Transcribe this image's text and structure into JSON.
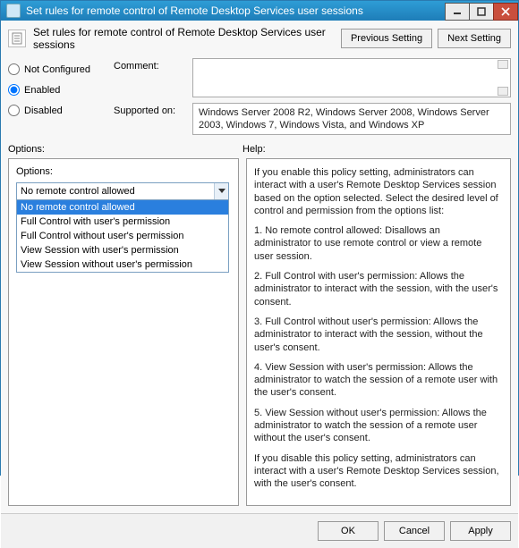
{
  "window": {
    "title": "Set rules for remote control of Remote Desktop Services user sessions"
  },
  "header": {
    "caption": "Set rules for remote control of Remote Desktop Services user sessions",
    "prev": "Previous Setting",
    "next": "Next Setting"
  },
  "state": {
    "not_configured": "Not Configured",
    "enabled": "Enabled",
    "disabled": "Disabled",
    "selected": "enabled"
  },
  "comment": {
    "label": "Comment:",
    "value": ""
  },
  "supported": {
    "label": "Supported on:",
    "value": "Windows Server 2008 R2, Windows Server 2008, Windows Server 2003, Windows 7, Windows Vista, and Windows XP"
  },
  "sections": {
    "options": "Options:",
    "help": "Help:"
  },
  "options": {
    "label": "Options:",
    "selected": "No remote control allowed",
    "items": [
      "No remote control allowed",
      "Full Control with user's permission",
      "Full Control without user's permission",
      "View Session with user's permission",
      "View Session without user's permission"
    ]
  },
  "help": {
    "paras": [
      "If you enable this policy setting, administrators can interact with a user's Remote Desktop Services session based on the option selected. Select the desired level of control and permission from the options list:",
      "1. No remote control allowed: Disallows an administrator to use remote control or view a remote user session.",
      "2. Full Control with user's permission: Allows the administrator to interact with the session, with the user's consent.",
      "3. Full Control without user's permission: Allows the administrator to interact with the session, without the user's consent.",
      "4. View Session with user's permission: Allows the administrator to watch the session of a remote user with the user's consent.",
      "5. View Session without user's permission: Allows the administrator to watch the session of a remote user without the user's consent.",
      "If you disable this policy setting, administrators can interact with a user's Remote Desktop Services session, with the user's consent."
    ]
  },
  "footer": {
    "ok": "OK",
    "cancel": "Cancel",
    "apply": "Apply"
  }
}
